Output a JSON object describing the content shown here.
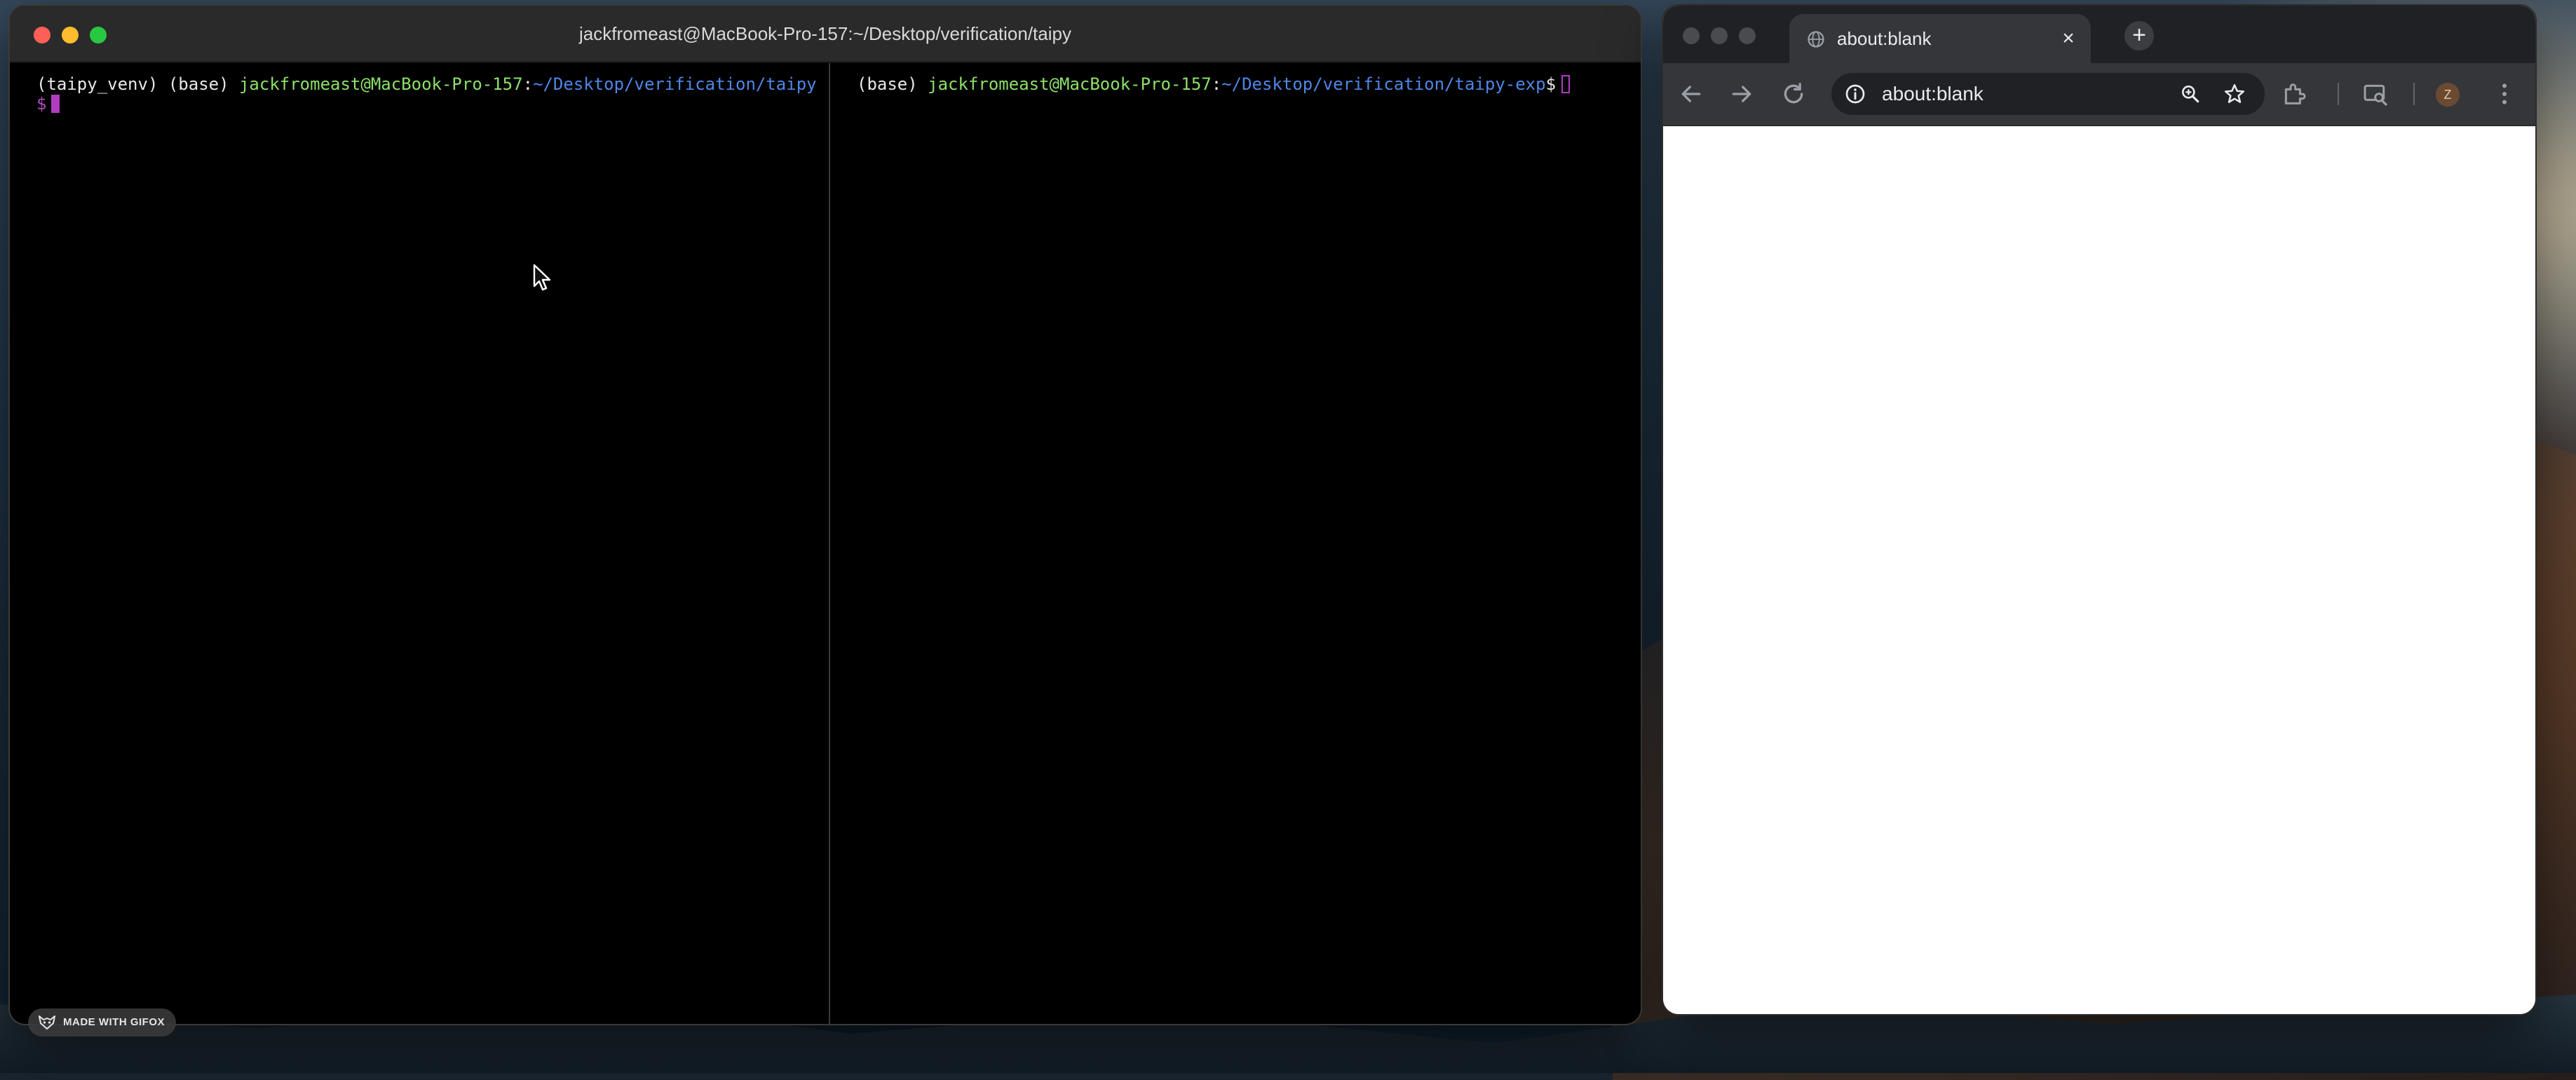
{
  "terminal": {
    "title": "jackfromeast@MacBook-Pro-157:~/Desktop/verification/taipy",
    "left_pane": {
      "venv_prefix": "(taipy_venv) (base) ",
      "user_host": "jackfromeast@MacBook-Pro-157",
      "colon": ":",
      "path": "~/Desktop/verification/taipy",
      "prompt_symbol": "$ "
    },
    "right_pane": {
      "prefix": "(base) ",
      "user_host": "jackfromeast@MacBook-Pro-157",
      "colon": ":",
      "path": "~/Desktop/verification/taipy-exp",
      "prompt_symbol": "$ "
    },
    "colors": {
      "user_host": "#8de06a",
      "path": "#4f86e8",
      "cursor": "#b13cc0"
    }
  },
  "badge": {
    "label": "MADE WITH GIFOX"
  },
  "browser": {
    "tab": {
      "title": "about:blank",
      "icon": "globe-icon",
      "close_icon": "close-icon"
    },
    "new_tab_icon": "plus-icon",
    "address_bar": {
      "url": "about:blank"
    },
    "toolbar_icons": [
      "back-icon",
      "forward-icon",
      "reload-icon",
      "info-icon",
      "zoom-icon",
      "star-icon",
      "extensions-icon",
      "tab-search-icon",
      "menu-icon"
    ],
    "profile_initial": "Z"
  }
}
